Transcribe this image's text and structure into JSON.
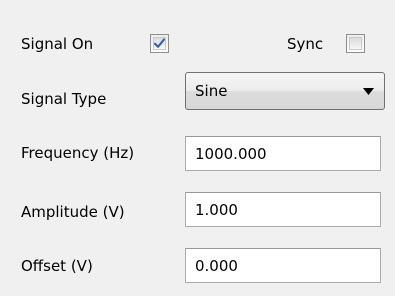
{
  "signal_on": {
    "label": "Signal On",
    "checked": true
  },
  "sync": {
    "label": "Sync",
    "checked": false
  },
  "signal_type": {
    "label": "Signal Type",
    "value": "Sine"
  },
  "frequency": {
    "label": "Frequency (Hz)",
    "value": "1000.000"
  },
  "amplitude": {
    "label": "Amplitude (V)",
    "value": "1.000"
  },
  "offset": {
    "label": "Offset (V)",
    "value": "0.000"
  },
  "icons": {
    "check": "check-icon",
    "dropdown_arrow": "triangle-down-icon"
  },
  "colors": {
    "background": "#f0f0f0",
    "check": "#3a5ba8",
    "field_border": "#ababab"
  }
}
